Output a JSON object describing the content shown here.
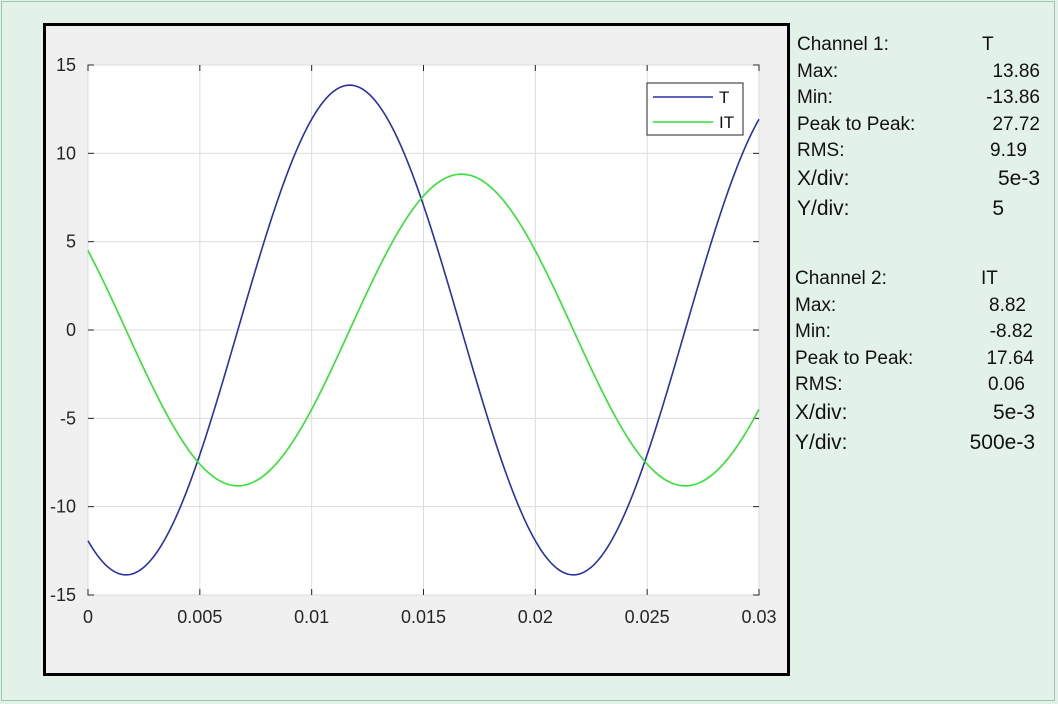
{
  "chart_data": {
    "type": "line",
    "xlim": [
      0,
      0.03
    ],
    "ylim": [
      -15,
      15
    ],
    "x_ticks": [
      "0",
      "0.005",
      "0.01",
      "0.015",
      "0.02",
      "0.025",
      "0.03"
    ],
    "y_ticks": [
      "15",
      "10",
      "5",
      "0",
      "-5",
      "-10",
      "-15"
    ],
    "grid": true,
    "legend_position": "top-right",
    "frequency_hz": 50,
    "series": [
      {
        "name": "T",
        "color": "#2b2fa8",
        "amplitude": 13.86,
        "peak_at_x": 0.0117
      },
      {
        "name": "IT",
        "color": "#33e233",
        "amplitude": 8.82,
        "peak_at_x": 0.0167
      }
    ]
  },
  "channels": [
    {
      "title": "Channel 1:",
      "name": "T",
      "rows": [
        {
          "label": "Max:",
          "value": "13.86"
        },
        {
          "label": "Min:",
          "value": "-13.86"
        },
        {
          "label": "Peak to Peak:",
          "value": "27.72"
        },
        {
          "label": "RMS:",
          "value": "9.19"
        },
        {
          "label": "X/div:",
          "value": "5e-3"
        },
        {
          "label": "Y/div:",
          "value": "5"
        }
      ]
    },
    {
      "title": "Channel 2:",
      "name": "IT",
      "rows": [
        {
          "label": "Max:",
          "value": "8.82"
        },
        {
          "label": "Min:",
          "value": "-8.82"
        },
        {
          "label": "Peak to Peak:",
          "value": "17.64"
        },
        {
          "label": "RMS:",
          "value": "0.06"
        },
        {
          "label": "X/div:",
          "value": "5e-3"
        },
        {
          "label": "Y/div:",
          "value": "500e-3"
        }
      ]
    }
  ]
}
